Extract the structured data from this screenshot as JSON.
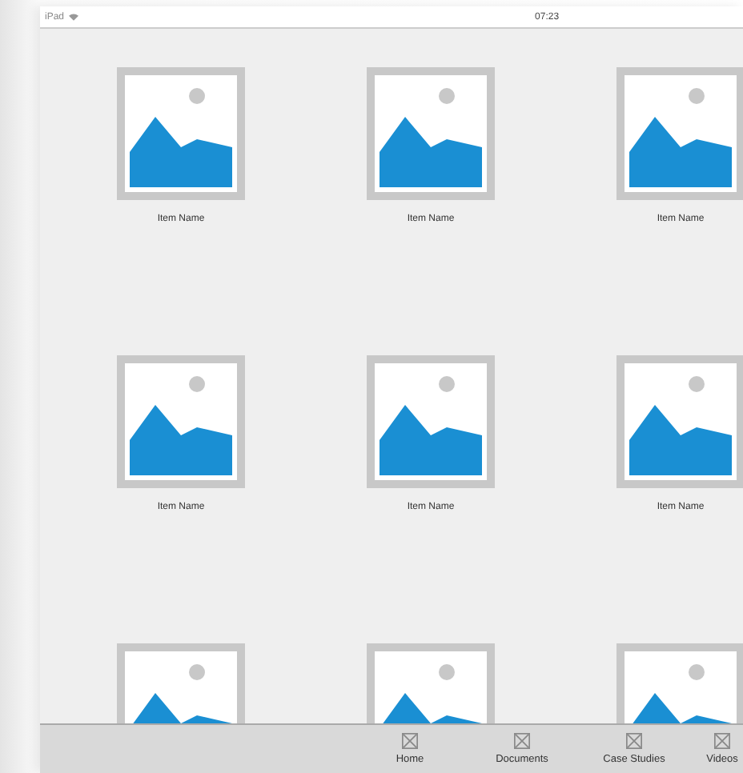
{
  "status_bar": {
    "device": "iPad",
    "time": "07:23"
  },
  "items": [
    {
      "kind": "labeled",
      "label": "Item Name"
    },
    {
      "kind": "labeled",
      "label": "Item Name"
    },
    {
      "kind": "labeled",
      "label": "Item Name"
    },
    {
      "kind": "labeled",
      "label": "Item Name"
    },
    {
      "kind": "labeled",
      "label": "Item Name"
    },
    {
      "kind": "labeled",
      "label": "Item Name"
    },
    {
      "kind": "cut_off"
    },
    {
      "kind": "cut_off"
    },
    {
      "kind": "cut_off"
    }
  ],
  "tab_bar": [
    {
      "label": "Home"
    },
    {
      "label": "Documents"
    },
    {
      "label": "Case Studies"
    },
    {
      "label": "Videos"
    }
  ]
}
